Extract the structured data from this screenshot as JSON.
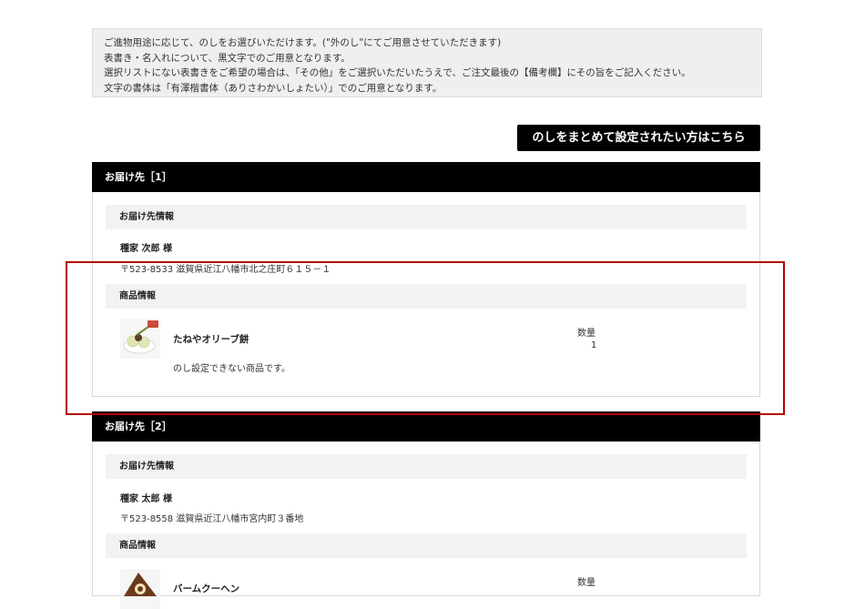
{
  "notice": {
    "lines": [
      "ご進物用途に応じて、のしをお選びいただけます。(\"外のし\"にてご用意させていただきます)",
      "表書き・名入れについて、黒文字でのご用意となります。",
      "選択リストにない表書きをご希望の場合は、「その他」をご選択いただいたうえで、ご注文最後の【備考欄】にその旨をご記入ください。",
      "文字の書体は「有澤楷書体（ありさわかいしょたい）」でのご用意となります。"
    ]
  },
  "bulk_button_label": "のしをまとめて設定されたい方はこちら",
  "destinations": [
    {
      "header": "お届け先［1］",
      "recipient_heading": "お届け先情報",
      "recipient_name": "種家 次郎 様",
      "address": "〒523-8533 滋賀県近江八幡市北之庄町６１５－１",
      "product_heading": "商品情報",
      "product_name": "たねやオリーブ餅",
      "product_note": "のし設定できない商品です。",
      "qty_label": "数量",
      "qty_value": "1"
    },
    {
      "header": "お届け先［2］",
      "recipient_heading": "お届け先情報",
      "recipient_name": "種家 太郎 様",
      "address": "〒523-8558 滋賀県近江八幡市宮内町３番地",
      "product_heading": "商品情報",
      "product_name": "バームクーヘン",
      "qty_label": "数量"
    }
  ],
  "colors": {
    "header_bg": "#000000",
    "subhead_bg": "#f2f2f2",
    "notice_bg": "#efefef",
    "highlight": "#b30000"
  },
  "icons": [
    "olive-mochi-product-image",
    "baumkuchen-product-image"
  ]
}
